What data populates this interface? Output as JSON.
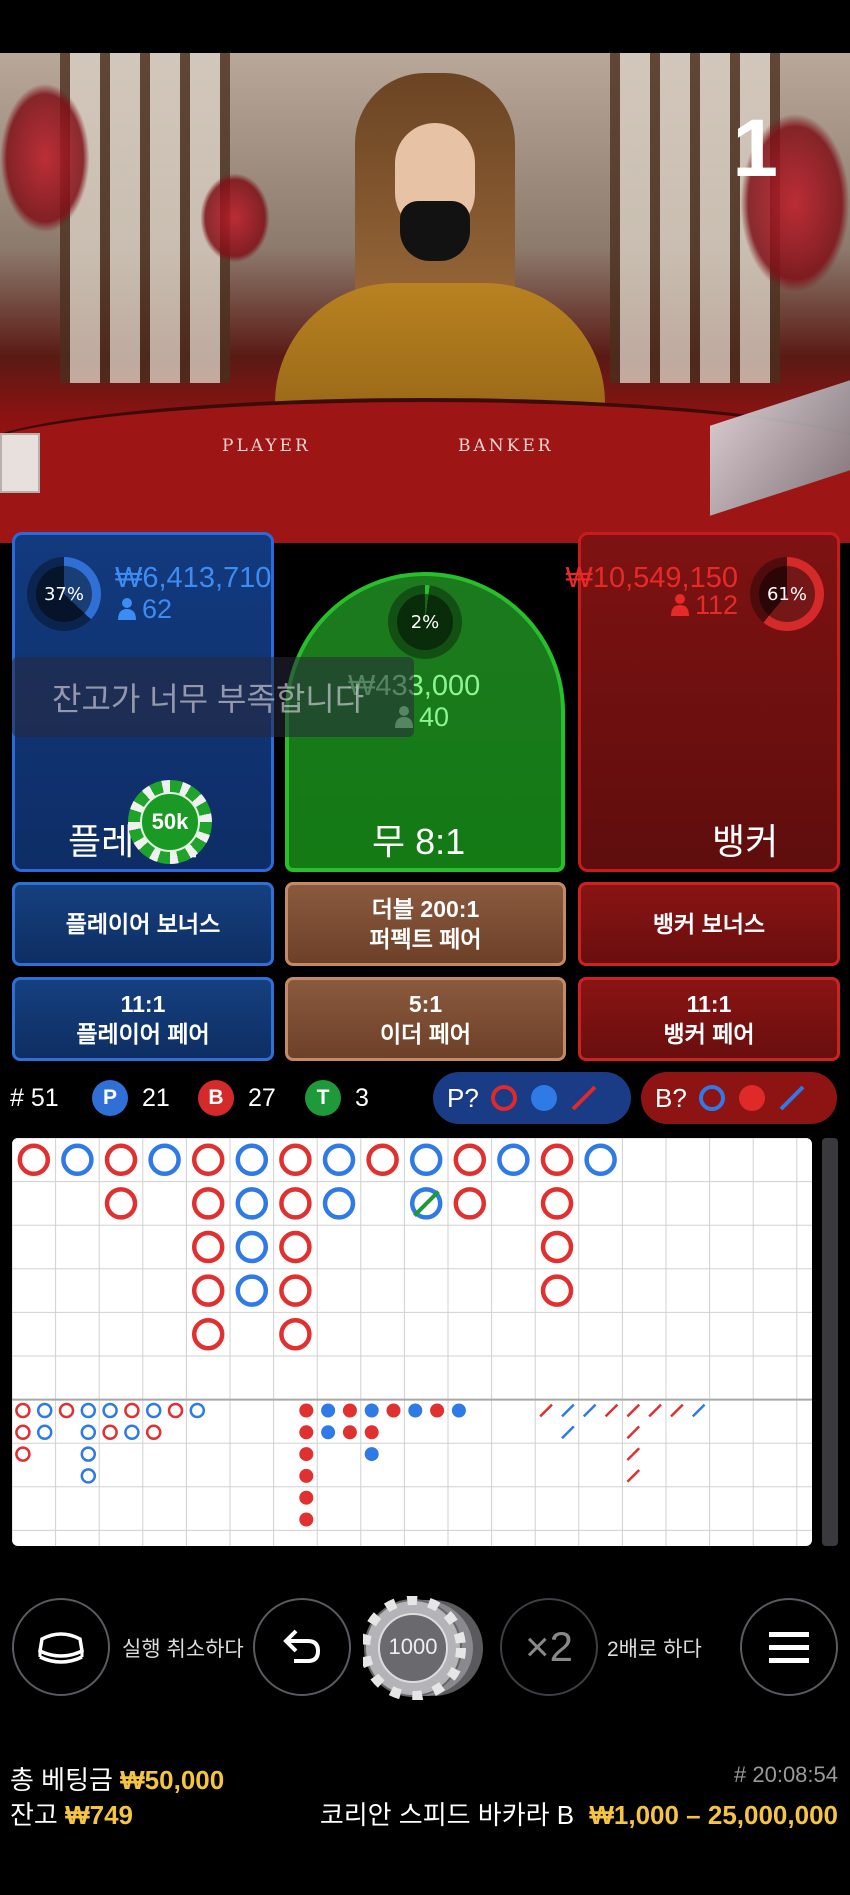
{
  "video": {
    "round_number": "1",
    "table_labels": [
      "PLAYER",
      "BANKER"
    ]
  },
  "player": {
    "percent": "37%",
    "percent_value": 37,
    "amount": "₩6,413,710",
    "count": "62",
    "label": "플레이어"
  },
  "banker": {
    "percent": "61%",
    "percent_value": 61,
    "amount": "₩10,549,150",
    "count": "112",
    "label": "뱅커"
  },
  "tie": {
    "percent": "2%",
    "percent_value": 2,
    "amount": "₩433,000",
    "count": "40",
    "label": "무 8:1"
  },
  "message": "잔고가 너무 부족합니다",
  "placed_chip": "50k",
  "side_bets": {
    "player_bonus": "플레이어 보너스",
    "perfect_pair_line1": "더블 200:1",
    "perfect_pair_line2": "퍼펙트 페어",
    "banker_bonus": "뱅커 보너스",
    "player_pair_line1": "11:1",
    "player_pair_line2": "플레이어 페어",
    "either_pair_line1": "5:1",
    "either_pair_line2": "이더 페어",
    "banker_pair_line1": "11:1",
    "banker_pair_line2": "뱅커 페어"
  },
  "stats": {
    "round_label": "# 51",
    "p_badge": "P",
    "p_count": "21",
    "b_badge": "B",
    "b_count": "27",
    "t_badge": "T",
    "t_count": "3",
    "player_predict": "P?",
    "banker_predict": "B?"
  },
  "controls": {
    "undo_label": "실행 취소하다",
    "chip_value": "1000",
    "double_icon_text": "×2",
    "double_label": "2배로 하다"
  },
  "footer": {
    "total_bet_label": "총 베팅금",
    "total_bet": "₩50,000",
    "balance_label": "잔고",
    "balance": "₩749",
    "time": "# 20:08:54",
    "table_name": "코리안 스피드 바카라 B",
    "limits": "₩1,000 – 25,000,000"
  },
  "colors": {
    "player": "#2f6fd6",
    "banker": "#d42a2a",
    "tie": "#27c02a",
    "gold": "#f6c443"
  }
}
